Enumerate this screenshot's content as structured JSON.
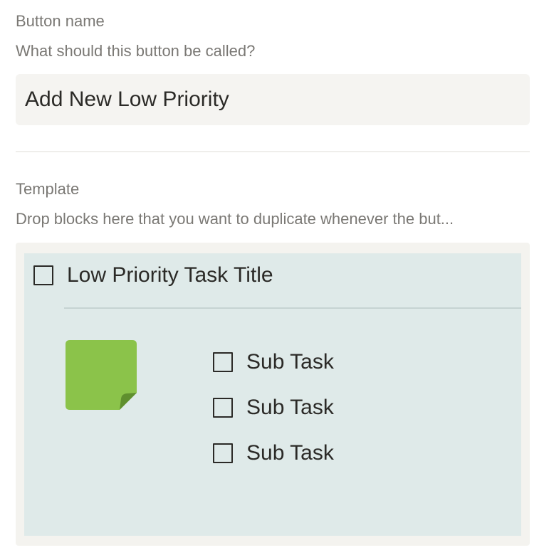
{
  "button_name": {
    "heading": "Button name",
    "description": "What should this button be called?",
    "value": "Add New Low Priority"
  },
  "template": {
    "heading": "Template",
    "description": "Drop blocks here that you want to duplicate whenever the but...",
    "task_title": "Low Priority Task Title",
    "sticky_icon": "sticky-note-icon",
    "sticky_color": "#8bc34a",
    "subtasks": [
      {
        "label": "Sub Task",
        "checked": false
      },
      {
        "label": "Sub Task",
        "checked": false
      },
      {
        "label": "Sub Task",
        "checked": false
      }
    ]
  },
  "colors": {
    "input_bg": "#f5f4f1",
    "template_bg": "#dfeae9",
    "text": "#2b2a27",
    "muted_text": "#7a7874"
  }
}
